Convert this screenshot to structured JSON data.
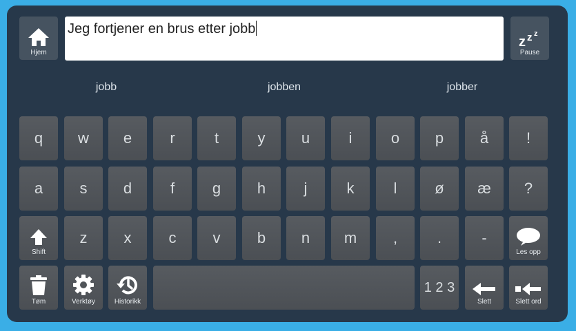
{
  "top": {
    "home_label": "Hjem",
    "pause_label": "Pause",
    "text_value": "Jeg fortjener en brus etter jobb"
  },
  "suggestions": [
    "jobb",
    "jobben",
    "jobber"
  ],
  "rows": {
    "r1": [
      "q",
      "w",
      "e",
      "r",
      "t",
      "y",
      "u",
      "i",
      "o",
      "p",
      "å",
      "!"
    ],
    "r2": [
      "a",
      "s",
      "d",
      "f",
      "g",
      "h",
      "j",
      "k",
      "l",
      "ø",
      "æ",
      "?"
    ],
    "r3": [
      "z",
      "x",
      "c",
      "v",
      "b",
      "n",
      "m",
      ",",
      ".",
      "-"
    ]
  },
  "fn": {
    "shift": "Shift",
    "read": "Les opp",
    "clear": "Tøm",
    "tools": "Verktøy",
    "history": "Historikk",
    "numbers": "1 2 3",
    "delete": "Slett",
    "delete_word": "Slett ord"
  },
  "colors": {
    "background": "#3aaee6",
    "panel": "#27384a",
    "key": "#53575c"
  },
  "icons": [
    "home-icon",
    "sleep-icon",
    "shift-arrow-icon",
    "speech-bubble-icon",
    "trash-icon",
    "gear-icon",
    "history-icon",
    "backspace-arrow-icon",
    "delete-word-icon"
  ]
}
